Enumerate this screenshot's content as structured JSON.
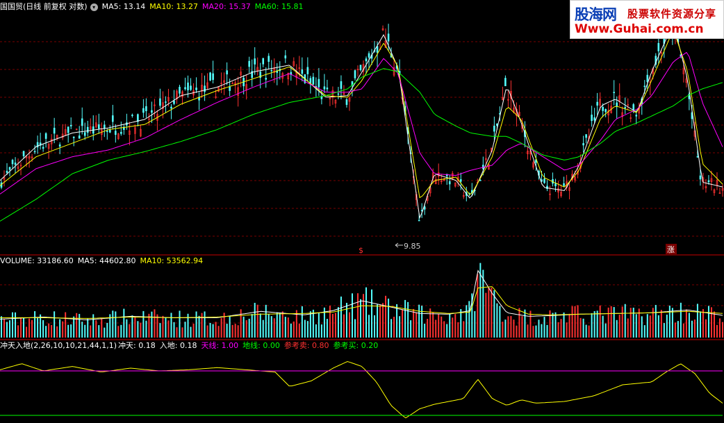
{
  "colors": {
    "up": "#ff3232",
    "down": "#54ffff",
    "ma5": "#ffffff",
    "ma10": "#ffff00",
    "ma20": "#ff00ff",
    "ma60": "#00ff00",
    "grid": "#7a0000",
    "separator": "#c80000"
  },
  "price_header": {
    "title": "国国贸(日线 前复权 对数)",
    "ma5": "MA5: 13.14",
    "ma10": "MA10: 13.27",
    "ma20": "MA20: 15.37",
    "ma60": "MA60: 15.81"
  },
  "volume_header": {
    "label": "VOLUME: 33186.60",
    "ma5": "MA5: 44602.80",
    "ma10": "MA10: 53562.94"
  },
  "indicator_header": {
    "name": "冲天入地(2,26,10,10,21,44,1,1)",
    "chongtian": "冲天: 0.18",
    "rudi": "入地: 0.18",
    "tianxian": "天线: 1.00",
    "dixian": "地线: 0.00",
    "cankao_mai": "参考卖: 0.80",
    "cankao_buy": "参考买: 0.20"
  },
  "annotations": {
    "low_label": "9.85",
    "marker_left": "$",
    "marker_right": "涨"
  },
  "watermark": {
    "name": "股海网",
    "slogan": "股票软件资源分享",
    "url": "Www.Guhai.com.cn"
  },
  "chart_data": [
    {
      "type": "line",
      "panel": "price",
      "title": "国国贸(日线 前复权 对数)",
      "x_range": [
        0,
        100
      ],
      "ylim": [
        9.5,
        23.5
      ],
      "series": [
        {
          "name": "MA5",
          "color": "#ffffff",
          "x": [
            0,
            5,
            10,
            15,
            20,
            25,
            30,
            35,
            40,
            45,
            48,
            50,
            53,
            55,
            58,
            60,
            63,
            65,
            68,
            70,
            72,
            75,
            78,
            80,
            83,
            85,
            88,
            90,
            93,
            95,
            97,
            100
          ],
          "values": [
            13.6,
            15.6,
            16.4,
            16.7,
            17.2,
            18.6,
            19.1,
            20,
            20.4,
            18.5,
            18.6,
            20,
            22.2,
            20.2,
            11.3,
            14,
            13.6,
            12.5,
            15.4,
            19.2,
            17,
            13.2,
            13,
            14.5,
            18,
            18.4,
            17.6,
            20,
            22.9,
            19.5,
            13.5,
            13.2
          ]
        },
        {
          "name": "MA10",
          "color": "#ffff00",
          "x": [
            0,
            5,
            10,
            15,
            20,
            25,
            30,
            35,
            40,
            45,
            48,
            50,
            53,
            55,
            58,
            60,
            63,
            65,
            68,
            70,
            72,
            75,
            78,
            80,
            83,
            85,
            88,
            90,
            93,
            95,
            97,
            100
          ],
          "values": [
            13.3,
            15,
            15.8,
            16.6,
            16.9,
            18.1,
            18.9,
            19.6,
            20.3,
            18.6,
            18.5,
            19.5,
            21.7,
            20.3,
            12.5,
            13.6,
            13.8,
            12.7,
            15,
            18,
            17.2,
            13.8,
            13.2,
            14.2,
            17.3,
            18,
            17.6,
            19.5,
            22.5,
            20,
            14.6,
            13.3
          ]
        },
        {
          "name": "MA20",
          "color": "#ff00ff",
          "x": [
            0,
            5,
            10,
            15,
            20,
            25,
            30,
            35,
            40,
            45,
            48,
            50,
            53,
            55,
            58,
            60,
            63,
            65,
            68,
            70,
            72,
            75,
            78,
            80,
            83,
            85,
            88,
            90,
            93,
            95,
            97,
            100
          ],
          "values": [
            12.8,
            14.3,
            15,
            15.4,
            16.1,
            17.2,
            18.2,
            19.1,
            19.9,
            18.8,
            18.8,
            19,
            20.8,
            19.9,
            15.2,
            14,
            13.9,
            14.2,
            14.5,
            15.4,
            15.8,
            15,
            14.2,
            14.5,
            16,
            17.2,
            17.8,
            18.6,
            20.6,
            21.2,
            18.2,
            15.4
          ]
        },
        {
          "name": "MA60",
          "color": "#00ff00",
          "x": [
            0,
            5,
            10,
            15,
            20,
            25,
            30,
            35,
            40,
            45,
            48,
            50,
            53,
            55,
            58,
            60,
            63,
            65,
            68,
            70,
            72,
            75,
            78,
            80,
            83,
            85,
            88,
            90,
            93,
            95,
            97,
            100
          ],
          "values": [
            11.2,
            12.5,
            14,
            14.8,
            15.3,
            15.9,
            16.6,
            17.5,
            18.2,
            18.6,
            19,
            19.7,
            20.2,
            20,
            18.8,
            17.5,
            16.8,
            16.4,
            16.2,
            16.2,
            15.8,
            15.1,
            14.8,
            15,
            15.8,
            16.5,
            17,
            17.4,
            18,
            18.6,
            19,
            19.4
          ]
        }
      ]
    },
    {
      "type": "bar",
      "panel": "volume",
      "title": "VOLUME",
      "x_range": [
        0,
        100
      ],
      "ylim": [
        0,
        100000
      ],
      "series": [
        {
          "name": "MA5",
          "color": "#ffffff",
          "x": [
            0,
            6,
            12,
            18,
            24,
            30,
            36,
            42,
            46,
            50,
            54,
            58,
            62,
            65,
            66,
            68,
            70,
            73,
            76,
            80,
            85,
            90,
            95,
            100
          ],
          "values": [
            26000,
            29000,
            25000,
            30000,
            28000,
            28000,
            37000,
            32000,
            38000,
            52000,
            43000,
            34000,
            33000,
            38000,
            95000,
            62000,
            35000,
            30000,
            31000,
            33000,
            34000,
            35000,
            39000,
            31000
          ]
        },
        {
          "name": "MA10",
          "color": "#ffff00",
          "x": [
            0,
            6,
            12,
            18,
            24,
            30,
            36,
            42,
            46,
            50,
            54,
            58,
            62,
            65,
            66,
            68,
            70,
            73,
            76,
            80,
            85,
            90,
            95,
            100
          ],
          "values": [
            28000,
            28000,
            27000,
            29000,
            28000,
            29000,
            33000,
            34000,
            36000,
            45000,
            44000,
            37000,
            34000,
            36000,
            70000,
            72000,
            45000,
            33000,
            32000,
            33000,
            34000,
            35000,
            37000,
            34000
          ]
        }
      ]
    },
    {
      "type": "line",
      "panel": "indicator",
      "title": "冲天入地",
      "x_range": [
        0,
        100
      ],
      "ylim": [
        -0.1,
        1.15
      ],
      "series": [
        {
          "name": "冲天",
          "color": "#ffff00",
          "x": [
            0,
            3,
            6,
            10,
            14,
            18,
            22,
            26,
            30,
            34,
            38,
            40,
            43,
            46,
            48,
            50,
            52,
            54,
            56,
            58,
            60,
            62,
            64,
            66,
            68,
            70,
            72,
            74,
            78,
            82,
            86,
            90,
            92,
            94,
            96,
            98,
            100
          ],
          "values": [
            0.82,
            0.93,
            0.8,
            0.88,
            0.78,
            0.85,
            0.8,
            0.82,
            0.86,
            0.82,
            0.78,
            0.52,
            0.62,
            0.85,
            0.97,
            0.88,
            0.6,
            0.18,
            -0.05,
            0.12,
            0.2,
            0.25,
            0.3,
            0.65,
            0.3,
            0.18,
            0.28,
            0.22,
            0.25,
            0.35,
            0.55,
            0.6,
            0.78,
            0.93,
            0.75,
            0.4,
            0.2
          ]
        },
        {
          "name": "天线",
          "color": "#ff00ff",
          "x": [
            0,
            100
          ],
          "values": [
            0.8,
            0.8
          ]
        },
        {
          "name": "地线",
          "color": "#00ff00",
          "x": [
            0,
            100
          ],
          "values": [
            0,
            0
          ]
        }
      ]
    }
  ]
}
